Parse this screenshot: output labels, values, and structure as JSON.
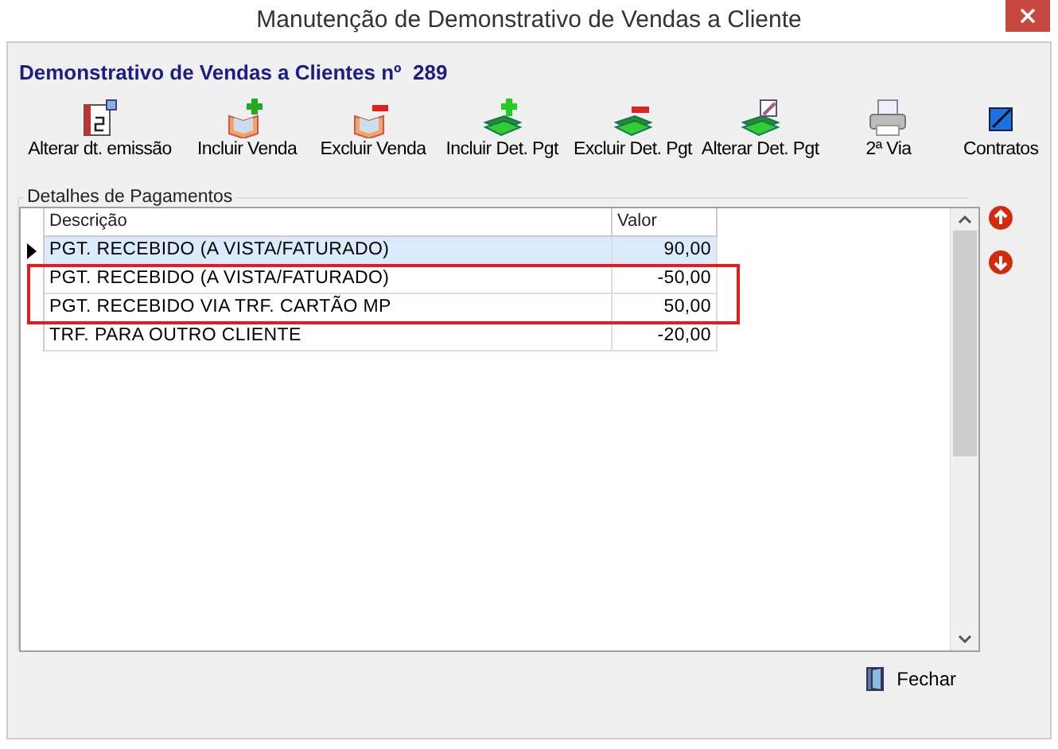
{
  "window": {
    "title": "Manutenção de Demonstrativo de Vendas a Cliente"
  },
  "heading": "Demonstrativo de Vendas a Clientes nº  289",
  "toolbar": [
    {
      "label": "Alterar dt. emissão",
      "kind": "calendar"
    },
    {
      "label": "Incluir Venda",
      "kind": "book-add"
    },
    {
      "label": "Excluir Venda",
      "kind": "book-remove"
    },
    {
      "label": "Incluir Det. Pgt",
      "kind": "money-add"
    },
    {
      "label": "Excluir Det. Pgt",
      "kind": "money-remove"
    },
    {
      "label": "Alterar Det. Pgt",
      "kind": "money-edit"
    },
    {
      "label": "2ª Via",
      "kind": "printer"
    },
    {
      "label": "Contratos",
      "kind": "contract"
    }
  ],
  "payments": {
    "title": "Detalhes de Pagamentos",
    "columns": [
      "Descrição",
      "Valor"
    ],
    "rows": [
      {
        "description": "PGT. RECEBIDO (A VISTA/FATURADO)",
        "value": "90,00",
        "selected": true,
        "highlighted": false
      },
      {
        "description": "PGT. RECEBIDO (A VISTA/FATURADO)",
        "value": "-50,00",
        "selected": false,
        "highlighted": true
      },
      {
        "description": "PGT. RECEBIDO VIA TRF. CARTÃO MP",
        "value": "50,00",
        "selected": false,
        "highlighted": true
      },
      {
        "description": "TRF. PARA OUTRO CLIENTE",
        "value": "-20,00",
        "selected": false,
        "highlighted": false
      }
    ]
  },
  "buttons": {
    "close": "Fechar"
  }
}
